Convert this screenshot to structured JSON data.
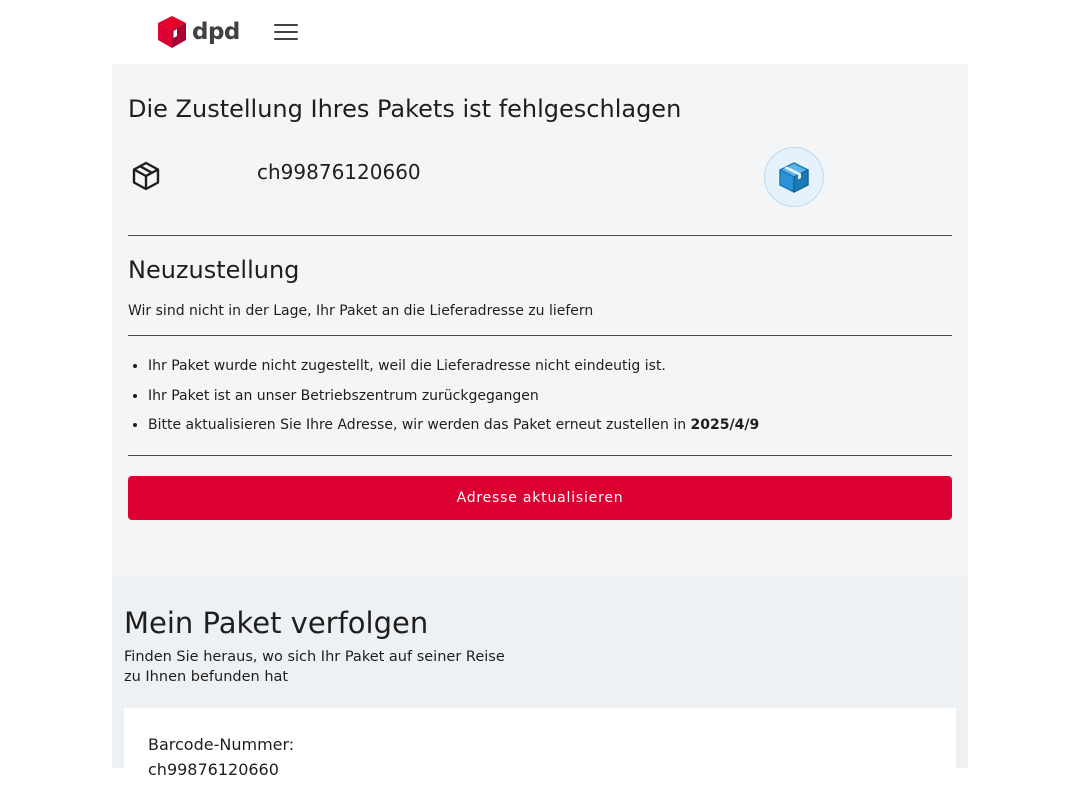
{
  "header": {
    "brand": "dpd",
    "brand_color": "#dc0032",
    "menu_icon": "hamburger-menu-icon"
  },
  "delivery": {
    "title": "Die Zustellung Ihres Pakets ist fehlgeschlagen",
    "tracking_number": "ch99876120660",
    "section_title": "Neuzustellung",
    "lead": "Wir sind nicht in der Lage, Ihr Paket an die Lieferadresse zu liefern",
    "reasons": [
      "Ihr Paket wurde nicht zugestellt, weil die Lieferadresse nicht eindeutig ist.",
      "Ihr Paket ist an unser Betriebszentrum zurückgegangen"
    ],
    "reschedule_text": "Bitte aktualisieren Sie Ihre Adresse, wir werden das Paket erneut zustellen in ",
    "reschedule_date": "2025/4/9",
    "cta_label": "Adresse aktualisieren",
    "cta_color": "#dc0032"
  },
  "tracking": {
    "title": "Mein Paket verfolgen",
    "subtitle": "Finden Sie heraus, wo sich Ihr Paket auf seiner Reise zu Ihnen befunden hat",
    "barcode_label": "Barcode-Nummer:",
    "barcode_value": "ch99876120660"
  }
}
